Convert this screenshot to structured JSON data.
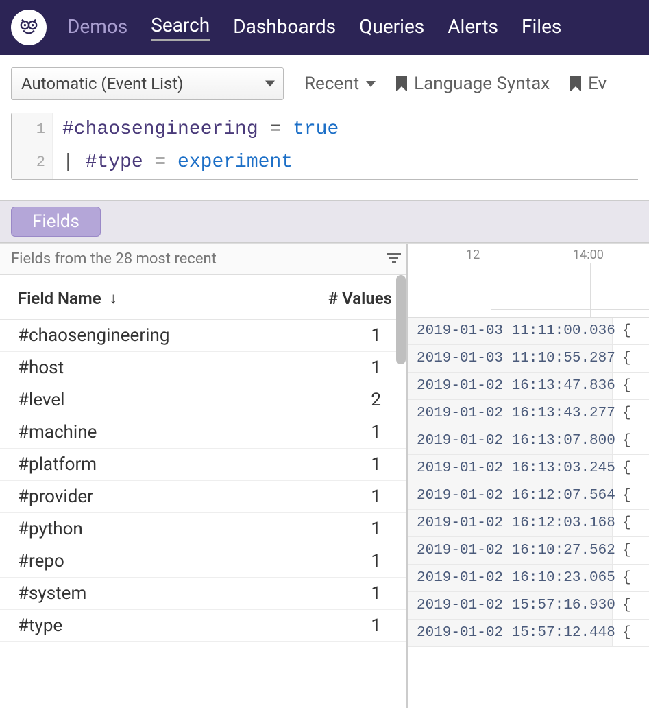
{
  "nav": {
    "items": [
      {
        "label": "Demos",
        "state": "dim"
      },
      {
        "label": "Search",
        "state": "active"
      },
      {
        "label": "Dashboards",
        "state": ""
      },
      {
        "label": "Queries",
        "state": ""
      },
      {
        "label": "Alerts",
        "state": ""
      },
      {
        "label": "Files",
        "state": ""
      }
    ]
  },
  "toolbar": {
    "view_select": "Automatic (Event List)",
    "recent": "Recent",
    "lang_syntax": "Language Syntax",
    "events_link": "Ev"
  },
  "query": {
    "lines": [
      {
        "n": "1",
        "tokens": [
          {
            "cls": "tok-field",
            "t": "#chaosengineering"
          },
          {
            "cls": "tok-op",
            "t": " = "
          },
          {
            "cls": "tok-val",
            "t": "true"
          }
        ]
      },
      {
        "n": "2",
        "tokens": [
          {
            "cls": "tok-pipe",
            "t": "| "
          },
          {
            "cls": "tok-field",
            "t": "#type"
          },
          {
            "cls": "tok-op",
            "t": " = "
          },
          {
            "cls": "tok-val",
            "t": "experiment"
          }
        ]
      }
    ]
  },
  "tabs": {
    "fields_label": "Fields"
  },
  "fields_panel": {
    "summary": "Fields from the 28 most recent",
    "col_name_header": "Field Name",
    "col_vals_header": "# Values",
    "rows": [
      {
        "name": "#chaosengineering",
        "count": "1"
      },
      {
        "name": "#host",
        "count": "1"
      },
      {
        "name": "#level",
        "count": "2"
      },
      {
        "name": "#machine",
        "count": "1"
      },
      {
        "name": "#platform",
        "count": "1"
      },
      {
        "name": "#provider",
        "count": "1"
      },
      {
        "name": "#python",
        "count": "1"
      },
      {
        "name": "#repo",
        "count": "1"
      },
      {
        "name": "#system",
        "count": "1"
      },
      {
        "name": "#type",
        "count": "1"
      }
    ]
  },
  "timeline": {
    "tick1": "12",
    "tick2": "14:00"
  },
  "events": [
    {
      "ts": "2019-01-03 11:11:00.036",
      "body": "{"
    },
    {
      "ts": "2019-01-03 11:10:55.287",
      "body": "{"
    },
    {
      "ts": "2019-01-02 16:13:47.836",
      "body": "{"
    },
    {
      "ts": "2019-01-02 16:13:43.277",
      "body": "{"
    },
    {
      "ts": "2019-01-02 16:13:07.800",
      "body": "{"
    },
    {
      "ts": "2019-01-02 16:13:03.245",
      "body": "{"
    },
    {
      "ts": "2019-01-02 16:12:07.564",
      "body": "{"
    },
    {
      "ts": "2019-01-02 16:12:03.168",
      "body": "{"
    },
    {
      "ts": "2019-01-02 16:10:27.562",
      "body": "{"
    },
    {
      "ts": "2019-01-02 16:10:23.065",
      "body": "{"
    },
    {
      "ts": "2019-01-02 15:57:16.930",
      "body": "{"
    },
    {
      "ts": "2019-01-02 15:57:12.448",
      "body": "{"
    }
  ]
}
